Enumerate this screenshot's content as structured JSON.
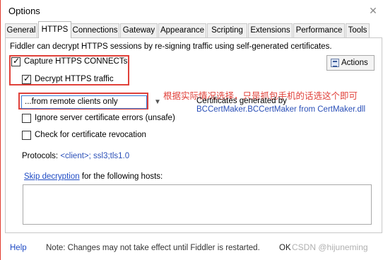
{
  "window": {
    "title": "Options",
    "close_label": "✕",
    "accent_color": "#e23a2e"
  },
  "tabs": [
    {
      "label": "General"
    },
    {
      "label": "HTTPS"
    },
    {
      "label": "Connections"
    },
    {
      "label": "Gateway"
    },
    {
      "label": "Appearance"
    },
    {
      "label": "Scripting"
    },
    {
      "label": "Extensions"
    },
    {
      "label": "Performance"
    },
    {
      "label": "Tools"
    }
  ],
  "active_tab": "HTTPS",
  "https": {
    "intro": "Fiddler can decrypt HTTPS sessions by re-signing traffic using self-generated certificates.",
    "capture_connects": {
      "label": "Capture HTTPS CONNECTs",
      "checked": true
    },
    "decrypt_traffic": {
      "label": "Decrypt HTTPS traffic",
      "checked": true
    },
    "actions_label": "Actions",
    "source_dropdown": {
      "selected": "...from remote clients only"
    },
    "annotation": "根据实际情况选择，只是抓包手机的话选这个即可",
    "cert_generated_label": "Certificates generated by",
    "cert_generator": "BCCertMaker.BCCertMaker from CertMaker.dll",
    "ignore_errors": {
      "label": "Ignore server certificate errors (unsafe)",
      "checked": false
    },
    "check_revocation": {
      "label": "Check for certificate revocation",
      "checked": false
    },
    "protocols_label": "Protocols:",
    "protocols_value": "<client>; ssl3;tls1.0",
    "skip_link": "Skip decryption",
    "skip_suffix": " for the following hosts:",
    "hosts_value": ""
  },
  "footer": {
    "help_label": "Help",
    "note": "Note: Changes may not take effect until Fiddler is restarted.",
    "ok_label": "OK",
    "watermark": "CSDN @hijuneming"
  },
  "colors": {
    "highlight_box": "#e0413a",
    "link": "#1f4bc4"
  }
}
